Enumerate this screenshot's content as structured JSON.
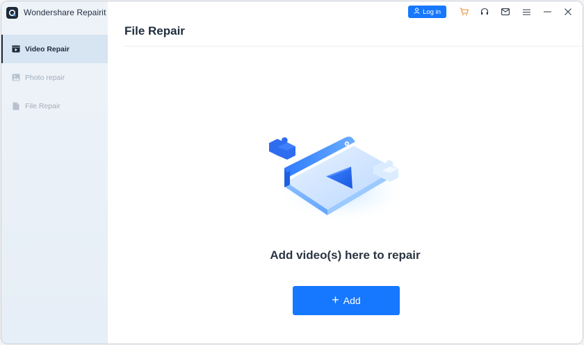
{
  "app": {
    "name": "Wondershare Repairit"
  },
  "sidebar": {
    "items": [
      {
        "label": "Video Repair",
        "active": true,
        "icon": "video-icon"
      },
      {
        "label": "Photo repair",
        "active": false,
        "icon": "image-icon"
      },
      {
        "label": "File Repair",
        "active": false,
        "icon": "file-icon"
      }
    ]
  },
  "titlebar": {
    "login_label": "Log in",
    "icons": [
      "user-icon",
      "cart-icon",
      "headset-icon",
      "mail-icon",
      "menu-icon",
      "minimize-icon",
      "close-icon"
    ]
  },
  "main": {
    "title": "File Repair",
    "prompt": "Add video(s) here to repair",
    "add_label": "Add"
  },
  "colors": {
    "accent": "#1677ff",
    "cart": "#f08a24",
    "sidebar_active": "#d7e4f2"
  }
}
